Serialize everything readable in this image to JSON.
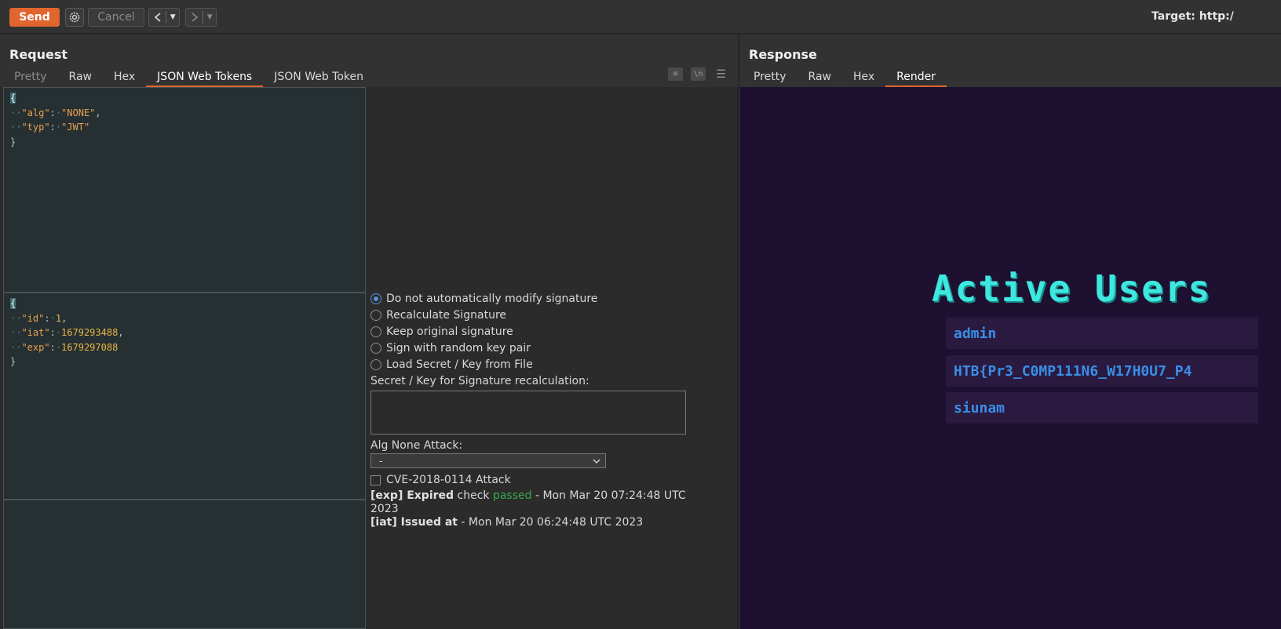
{
  "toolbar": {
    "send_label": "Send",
    "cancel_label": "Cancel",
    "target_label": "Target: http:/"
  },
  "request": {
    "title": "Request",
    "tabs": [
      {
        "label": "Pretty",
        "state": "disabled"
      },
      {
        "label": "Raw",
        "state": "normal"
      },
      {
        "label": "Hex",
        "state": "normal"
      },
      {
        "label": "JSON Web Tokens",
        "state": "active"
      },
      {
        "label": "JSON Web Token",
        "state": "normal"
      }
    ],
    "editor_icons": [
      "wrap-icon",
      "newline-icon",
      "menu-icon"
    ],
    "header_json": {
      "open": "{",
      "lines": [
        {
          "key": "\"alg\"",
          "val": "\"NONE\"",
          "comma": ","
        },
        {
          "key": "\"typ\"",
          "val": "\"JWT\"",
          "comma": ""
        }
      ],
      "close": "}"
    },
    "payload_json": {
      "open": "{",
      "lines": [
        {
          "key": "\"id\"",
          "val": "1",
          "comma": ","
        },
        {
          "key": "\"iat\"",
          "val": "1679293488",
          "comma": ","
        },
        {
          "key": "\"exp\"",
          "val": "1679297088",
          "comma": ""
        }
      ],
      "close": "}"
    },
    "signature_options": [
      {
        "label": "Do not automatically modify signature",
        "selected": true
      },
      {
        "label": "Recalculate Signature",
        "selected": false
      },
      {
        "label": "Keep original signature",
        "selected": false
      },
      {
        "label": "Sign with random key pair",
        "selected": false
      },
      {
        "label": "Load Secret / Key from File",
        "selected": false
      }
    ],
    "secret_label": "Secret / Key for Signature recalculation:",
    "secret_value": "",
    "alg_none_label": "Alg None Attack:",
    "alg_none_value": "-",
    "cve_label": "CVE-2018-0114 Attack",
    "cve_checked": false,
    "exp_info": {
      "tag": "[exp] Expired",
      "check": " check ",
      "status": "passed",
      "rest": " - Mon Mar 20 07:24:48 UTC 2023"
    },
    "iat_info": {
      "tag": "[iat] Issued at",
      "rest": " - Mon Mar 20 06:24:48 UTC 2023"
    }
  },
  "response": {
    "title": "Response",
    "tabs": [
      {
        "label": "Pretty",
        "state": "normal"
      },
      {
        "label": "Raw",
        "state": "normal"
      },
      {
        "label": "Hex",
        "state": "normal"
      },
      {
        "label": "Render",
        "state": "active"
      }
    ],
    "render": {
      "heading": "Active Users",
      "users": [
        "admin",
        "HTB{Pr3_C0MP111N6_W17H0U7_P4",
        "siunam"
      ]
    }
  },
  "colors": {
    "accent": "#e0652f",
    "render_bg": "#1e1030",
    "heading": "#3ee8e0",
    "user_text": "#3a8ee8",
    "passed": "#3aa84a"
  }
}
